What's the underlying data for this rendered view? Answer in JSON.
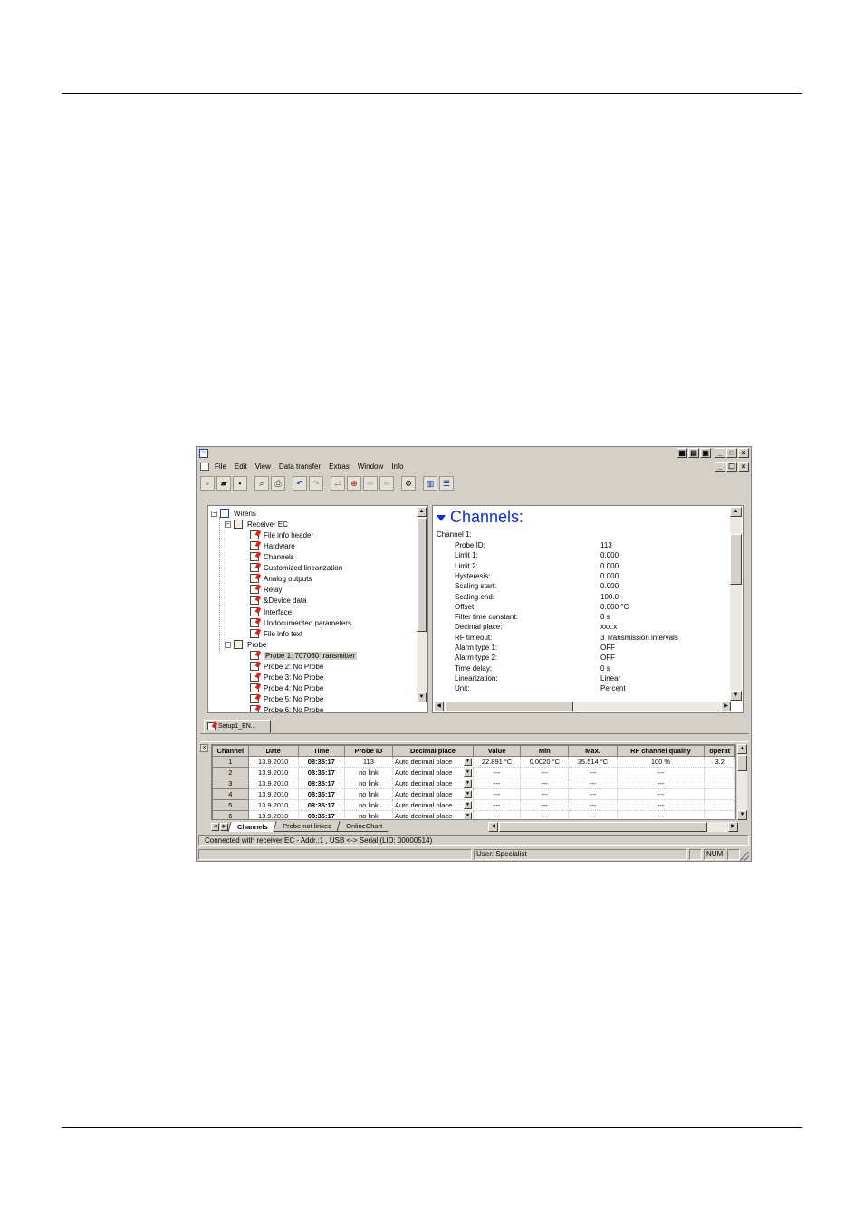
{
  "menu": [
    "File",
    "Edit",
    "View",
    "Data transfer",
    "Extras",
    "Window",
    "Info"
  ],
  "tree": {
    "root": "Wirens",
    "receiver": "Receiver EC",
    "receiver_items": [
      "File info header",
      "Hardware",
      "Channels",
      "Customized linearization",
      "Analog outputs",
      "Relay",
      "&Device data",
      "Interface",
      "Undocumented parameters",
      "File info text"
    ],
    "probe_folder": "Probe",
    "probes": [
      "Probe 1:  707060 transmitter",
      "Probe 2:  No Probe",
      "Probe 3:  No Probe",
      "Probe 4:  No Probe",
      "Probe 5:  No Probe",
      "Probe 6:  No Probe"
    ]
  },
  "detail": {
    "heading": "Channels:",
    "channel_name": "Channel 1:",
    "properties": [
      {
        "label": "Probe ID:",
        "value": "113"
      },
      {
        "label": "Limit 1:",
        "value": "0.000"
      },
      {
        "label": "Limit 2:",
        "value": "0.000"
      },
      {
        "label": "Hysteresis:",
        "value": "0.000"
      },
      {
        "label": "Scaling start:",
        "value": "0.000"
      },
      {
        "label": "Scaling end:",
        "value": "100.0"
      },
      {
        "label": "Offset:",
        "value": "0.000 °C"
      },
      {
        "label": "Filter time constant:",
        "value": "0 s"
      },
      {
        "label": "Decimal place:",
        "value": "xxx.x"
      },
      {
        "label": "RF timeout:",
        "value": "3 Transmission intervals"
      },
      {
        "label": "Alarm type 1:",
        "value": "OFF"
      },
      {
        "label": "Alarm type 2:",
        "value": "OFF"
      },
      {
        "label": "Time delay:",
        "value": "0 s"
      },
      {
        "label": "Linearization:",
        "value": "Linear"
      },
      {
        "label": "Unit:",
        "value": "Percent"
      }
    ]
  },
  "doc_tab": "Setup1_EN...",
  "grid": {
    "columns": [
      "Channel",
      "Date",
      "Time",
      "Probe ID",
      "Decimal place",
      "Value",
      "Min",
      "Max.",
      "RF channel quality",
      "operat"
    ],
    "rows": [
      [
        "1",
        "13.9.2010",
        "08:35:17",
        "113",
        "Auto decimal place",
        "22.891 °C",
        "0.0020 °C",
        "35.514 °C",
        "100 %",
        "3.2"
      ],
      [
        "2",
        "13.9.2010",
        "08:35:17",
        "no link",
        "Auto decimal place",
        "---",
        "---",
        "---",
        "---",
        ""
      ],
      [
        "3",
        "13.9.2010",
        "08:35:17",
        "no link",
        "Auto decimal place",
        "---",
        "---",
        "---",
        "---",
        ""
      ],
      [
        "4",
        "13.9.2010",
        "08:35:17",
        "no link",
        "Auto decimal place",
        "---",
        "---",
        "---",
        "---",
        ""
      ],
      [
        "5",
        "13.9.2010",
        "08:35:17",
        "no link",
        "Auto decimal place",
        "---",
        "---",
        "---",
        "---",
        ""
      ],
      [
        "6",
        "13.9.2010",
        "08:35:17",
        "no link",
        "Auto decimal place",
        "---",
        "---",
        "---",
        "---",
        ""
      ]
    ]
  },
  "sheet_tabs": [
    "Channels",
    "Probe not linked",
    "OnlineChart"
  ],
  "status": {
    "connection": "Connected with receiver EC - Addr.:1 , USB <-> Serial (LID: 00000514)",
    "user": "User: Specialist",
    "num": "NUM"
  }
}
